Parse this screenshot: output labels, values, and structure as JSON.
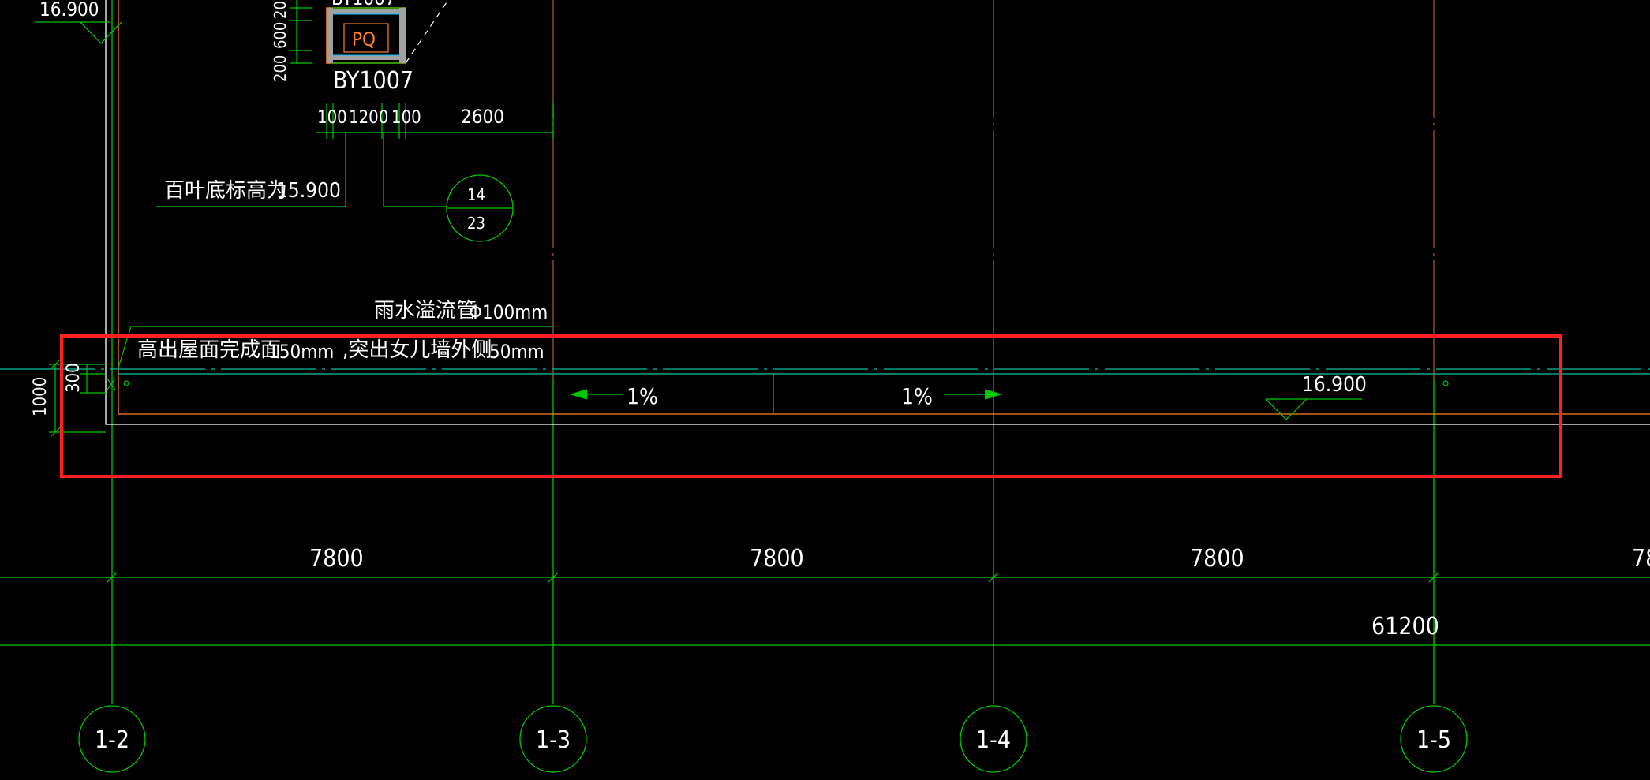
{
  "colors": {
    "background": "#000000",
    "grid_line": "#00c800",
    "dim_line": "#00c800",
    "text": "#ffffff",
    "wall_orange": "#ff7f27",
    "wall_white": "#ffffff",
    "axis_dark": "#a05a1e",
    "highlight": "#ff2020",
    "cyan_line": "#00c0a0"
  },
  "drawing": {
    "top_elevation": "16.900",
    "louver": {
      "tag": "PQ",
      "name": "BY1007",
      "partial_label": "BY1007",
      "vdims": [
        "200",
        "600",
        "200"
      ],
      "hdims": [
        "100",
        "1200",
        "100",
        "2600"
      ],
      "bottom_note_label": "百叶底标高为",
      "bottom_note_value": "15.900",
      "detail_bubble_top": "14",
      "detail_bubble_bottom": "23"
    },
    "overflow_pipe_label": "雨水溢流管",
    "overflow_pipe_size": "Φ100mm",
    "note_height_label": "高出屋面完成面",
    "note_height_value": "150mm",
    "note_protrude_label": ",突出女儿墙外侧",
    "note_protrude_value": "50mm",
    "left_dims": [
      "1000",
      "300"
    ],
    "slope_left": "1%",
    "slope_right": "1%",
    "roof_elevation": "16.900",
    "bay_dims": [
      "7800",
      "7800",
      "7800",
      "78"
    ],
    "total_dim": "61200",
    "axes": [
      "1-2",
      "1-3",
      "1-4",
      "1-5"
    ]
  }
}
